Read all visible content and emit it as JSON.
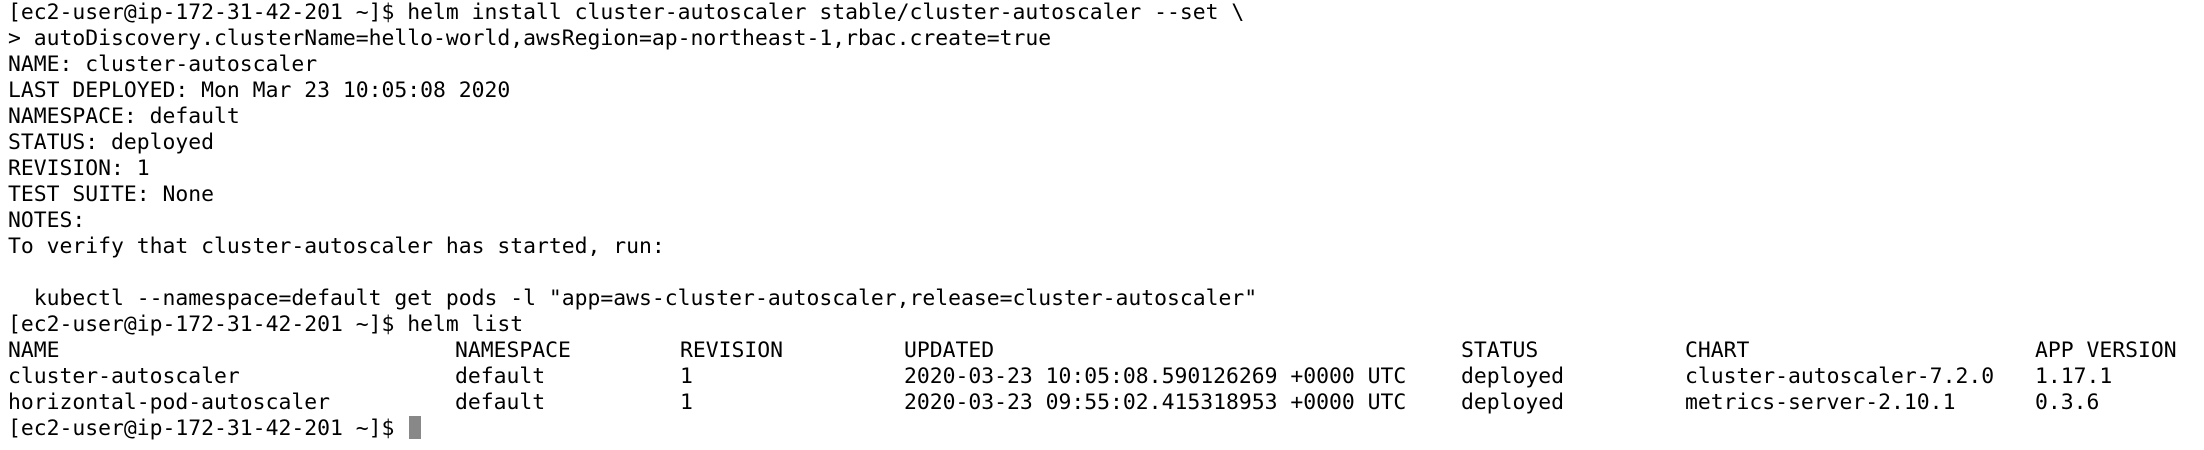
{
  "terminal": {
    "lines": [
      "[ec2-user@ip-172-31-42-201 ~]$ helm install cluster-autoscaler stable/cluster-autoscaler --set \\",
      "> autoDiscovery.clusterName=hello-world,awsRegion=ap-northeast-1,rbac.create=true",
      "NAME: cluster-autoscaler",
      "LAST DEPLOYED: Mon Mar 23 10:05:08 2020",
      "NAMESPACE: default",
      "STATUS: deployed",
      "REVISION: 1",
      "TEST SUITE: None",
      "NOTES:",
      "To verify that cluster-autoscaler has started, run:",
      "",
      "  kubectl --namespace=default get pods -l \"app=aws-cluster-autoscaler,release=cluster-autoscaler\"",
      "[ec2-user@ip-172-31-42-201 ~]$ helm list"
    ],
    "table": {
      "headers": {
        "name": "NAME",
        "namespace": "NAMESPACE",
        "revision": "REVISION",
        "updated": "UPDATED",
        "status": "STATUS",
        "chart": "CHART",
        "app_version": "APP VERSION"
      },
      "rows": [
        {
          "name": "cluster-autoscaler",
          "namespace": "default",
          "revision": "1",
          "updated": "2020-03-23 10:05:08.590126269 +0000 UTC",
          "status": "deployed",
          "chart": "cluster-autoscaler-7.2.0",
          "app_version": "1.17.1"
        },
        {
          "name": "horizontal-pod-autoscaler",
          "namespace": "default",
          "revision": "1",
          "updated": "2020-03-23 09:55:02.415318953 +0000 UTC",
          "status": "deployed",
          "chart": "metrics-server-2.10.1",
          "app_version": "0.3.6"
        }
      ]
    },
    "final_prompt": "[ec2-user@ip-172-31-42-201 ~]$ ",
    "colors": {
      "background": "#ffffff",
      "text": "#000000",
      "cursor": "#888888"
    }
  }
}
